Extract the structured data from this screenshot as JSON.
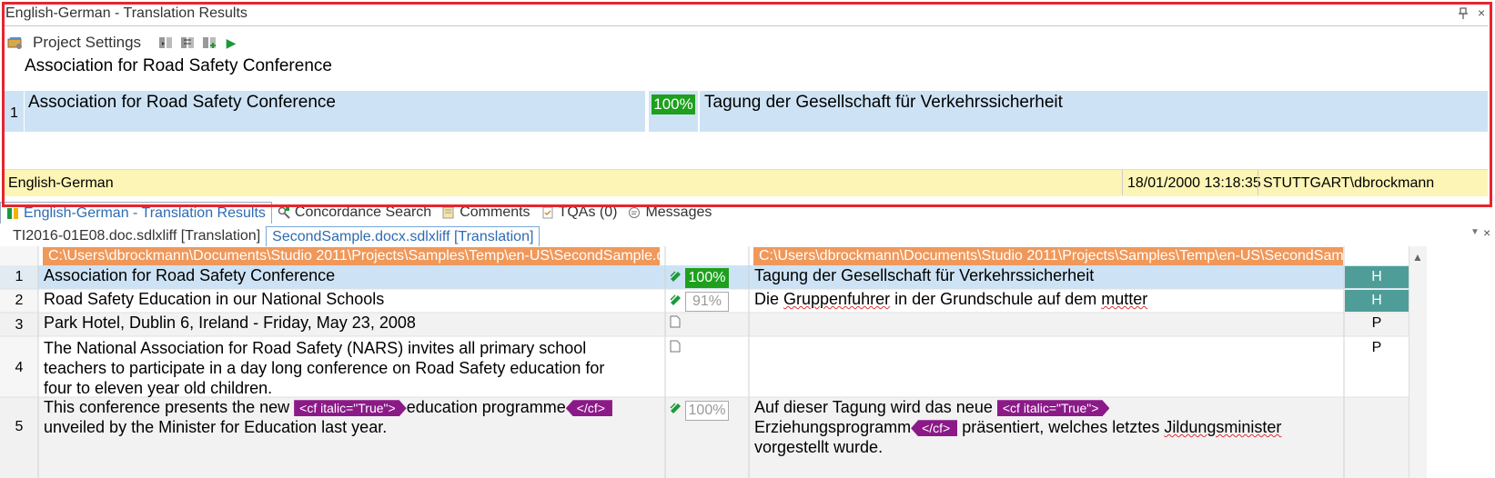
{
  "translation_results": {
    "title": "English-German - Translation Results",
    "toolbar": {
      "project_settings_label": "Project Settings"
    },
    "source_line": "Association for Road Safety Conference",
    "result": {
      "row_number": "1",
      "source": "Association for Road Safety Conference",
      "match": "100%",
      "target": "Tagung der Gesellschaft für Verkehrssicherheit"
    },
    "status": {
      "language_pair": "English-German",
      "date": "18/01/2000 13:18:35",
      "user": "STUTTGART\\dbrockmann"
    }
  },
  "tabs": [
    {
      "label": "English-German - Translation Results",
      "active": true
    },
    {
      "label": "Concordance Search",
      "active": false
    },
    {
      "label": "Comments",
      "active": false
    },
    {
      "label": "TQAs (0)",
      "active": false
    },
    {
      "label": "Messages",
      "active": false
    }
  ],
  "file_tabs": [
    {
      "label": "TI2016-01E08.doc.sdlxliff [Translation]",
      "active": false
    },
    {
      "label": "SecondSample.docx.sdlxliff [Translation]",
      "active": true
    }
  ],
  "editor": {
    "source_path": "C:\\Users\\dbrockmann\\Documents\\Studio 2011\\Projects\\Samples\\Temp\\en-US\\SecondSample.docx",
    "target_path": "C:\\Users\\dbrockmann\\Documents\\Studio 2011\\Projects\\Samples\\Temp\\en-US\\SecondSample.docx",
    "rows": [
      {
        "num": "1",
        "source": "Association for Road Safety Conference",
        "match": "100%",
        "target": "Tagung der Gesellschaft für Verkehrssicherheit",
        "status": "H"
      },
      {
        "num": "2",
        "source": "Road Safety Education in our National Schools",
        "match": "91%",
        "target_a": "Die ",
        "target_b": "Gruppenfuhrer",
        "target_c": " in der Grundschule auf dem ",
        "target_d": "mutter",
        "status": "H"
      },
      {
        "num": "3",
        "source": "Park Hotel, Dublin 6, Ireland - Friday, May 23, 2008",
        "status": "P"
      },
      {
        "num": "4",
        "source_l1": "The National Association for Road Safety (NARS) invites all primary school",
        "source_l2": "teachers to participate in a day long conference on Road Safety education for",
        "source_l3": "four to eleven year old children.",
        "status": "P"
      },
      {
        "num": "5",
        "source_a": "This conference presents the new ",
        "tag_open": "<cf italic=\"True\">",
        "source_b": "education programme",
        "tag_close": "</cf>",
        "source_l2": "unveiled by the Minister for Education last year.",
        "match": "100%",
        "target_a": "Auf dieser Tagung wird das neue ",
        "target_tag_open": "<cf italic=\"True\">",
        "target_b": "Erziehungsprogramm",
        "target_tag_close": "</cf>",
        "target_c": " präsentiert, welches letztes ",
        "target_d": "Jildungsminister",
        "target_l3": "vorgestellt wurde."
      }
    ]
  },
  "icons": {
    "pin": "pin-icon",
    "close": "close-icon",
    "play": "play-icon"
  },
  "colors": {
    "highlight_border": "#e8242f",
    "selected_row": "#cde3f5",
    "status_bar": "#fdf5b5",
    "match_exact": "#1ea01e",
    "path_bar": "#f0985a",
    "tag": "#8b1a88",
    "status_h": "#4e9d98"
  }
}
